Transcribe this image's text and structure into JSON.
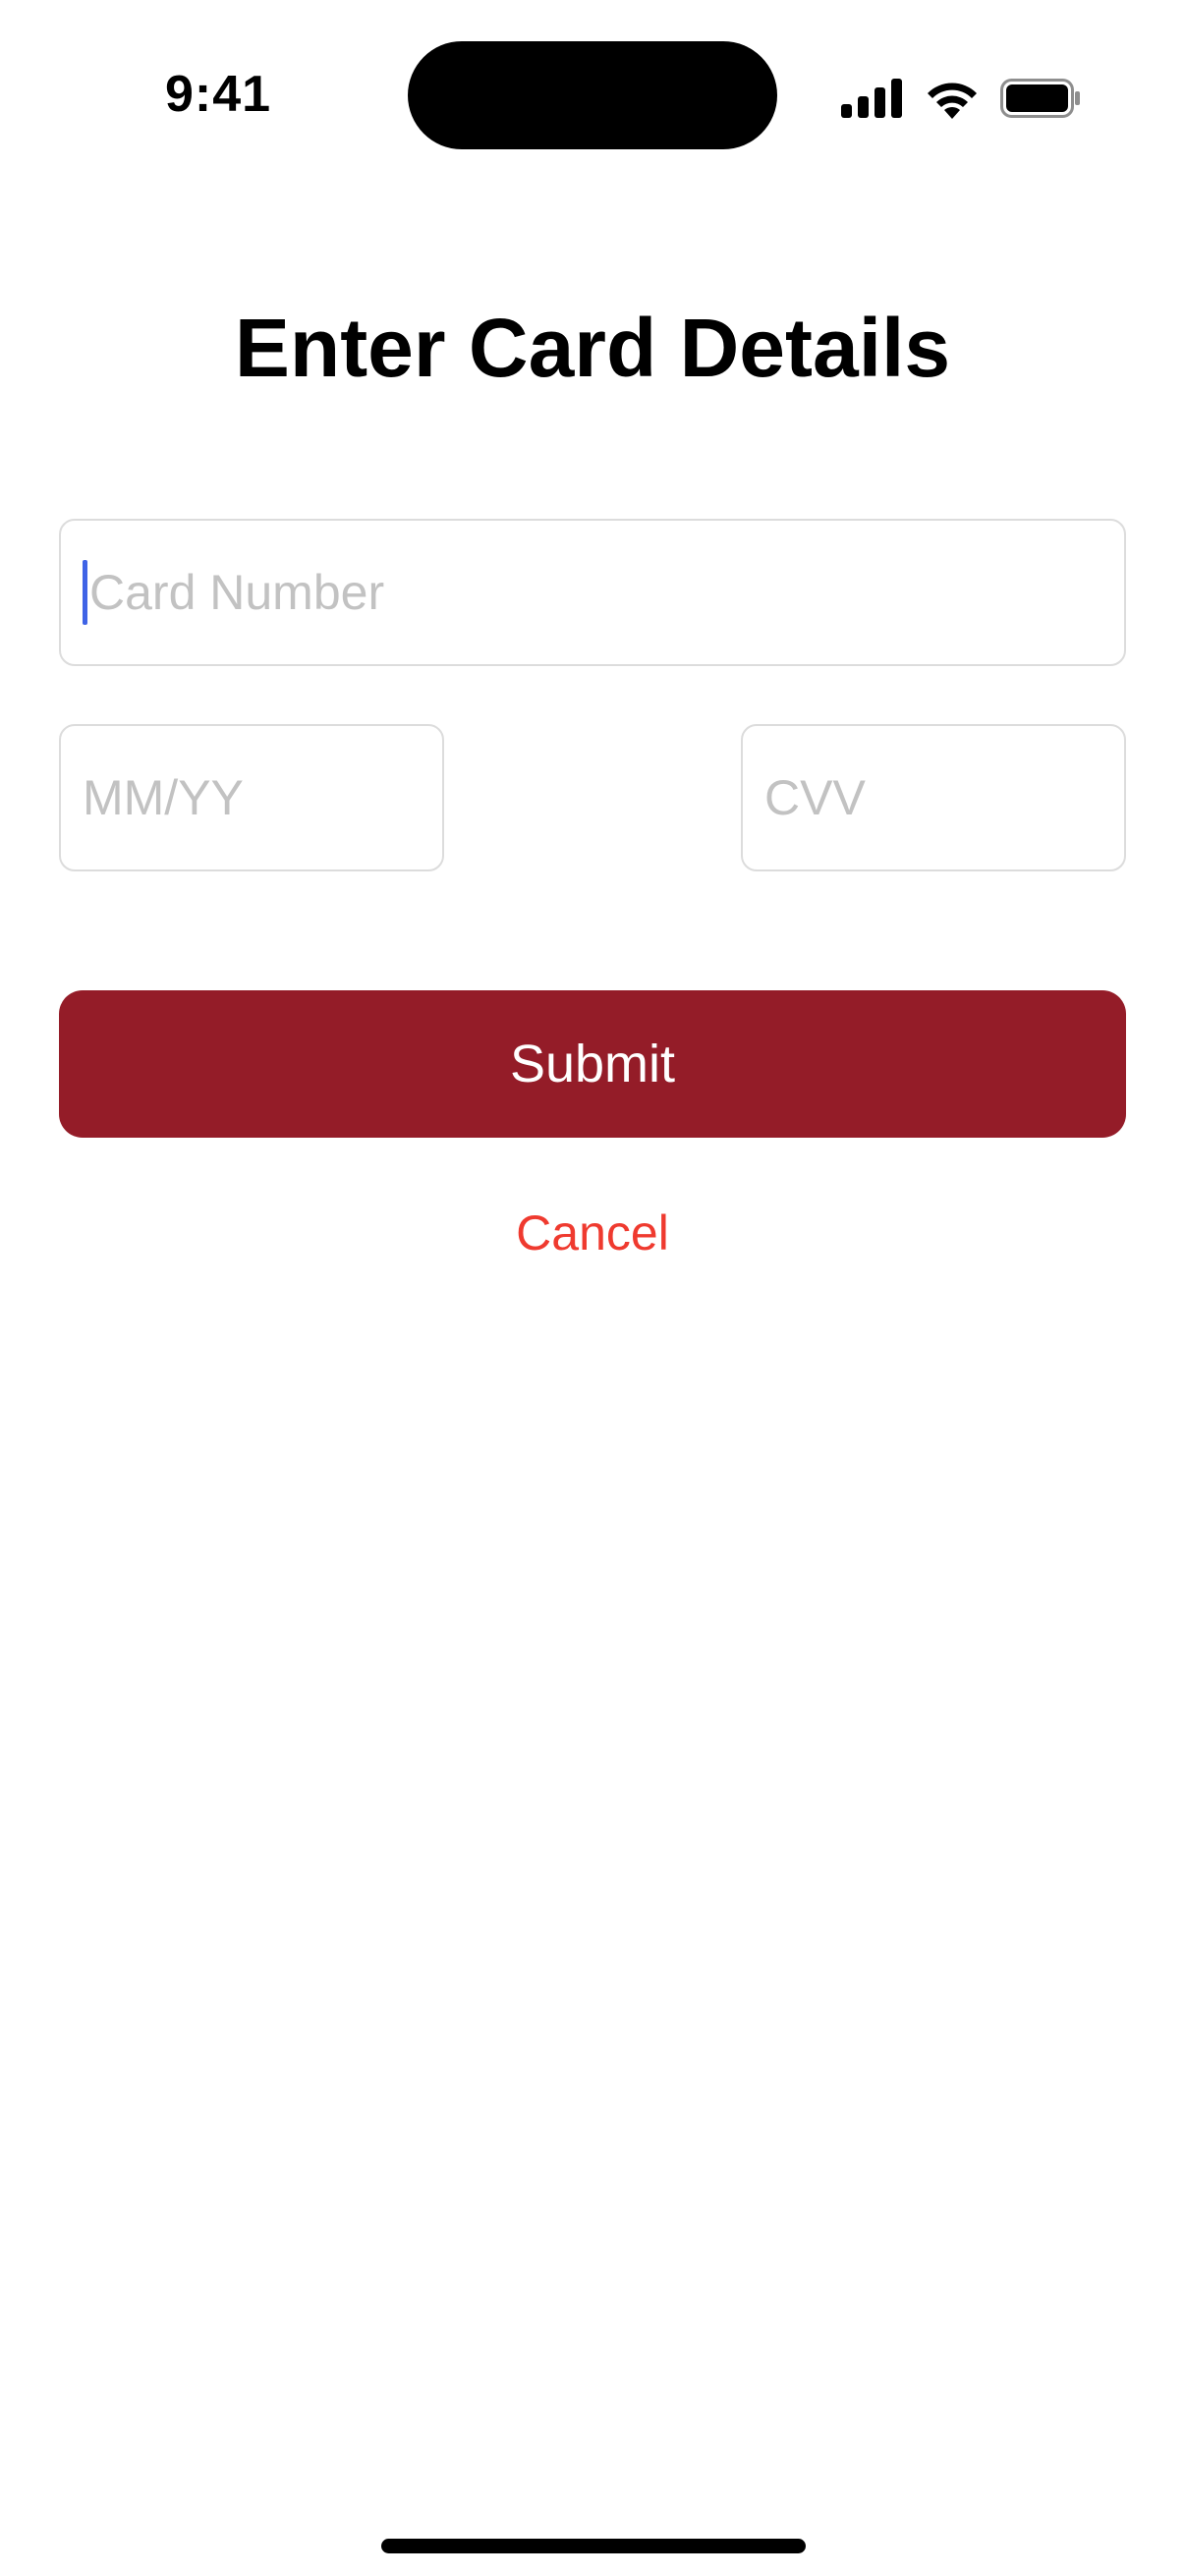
{
  "status_bar": {
    "time": "9:41",
    "icons": [
      "cellular-signal-icon",
      "wifi-icon",
      "battery-icon"
    ]
  },
  "page": {
    "title": "Enter Card Details"
  },
  "form": {
    "card_number": {
      "placeholder": "Card Number",
      "value": "",
      "focused": true
    },
    "expiry": {
      "placeholder": "MM/YY",
      "value": ""
    },
    "cvv": {
      "placeholder": "CVV",
      "value": ""
    }
  },
  "actions": {
    "submit_label": "Submit",
    "cancel_label": "Cancel"
  },
  "colors": {
    "submit_background": "#941c28",
    "cancel_text": "#ef3a2f",
    "caret": "#3f63e6",
    "placeholder_text": "#c2c2c2"
  }
}
